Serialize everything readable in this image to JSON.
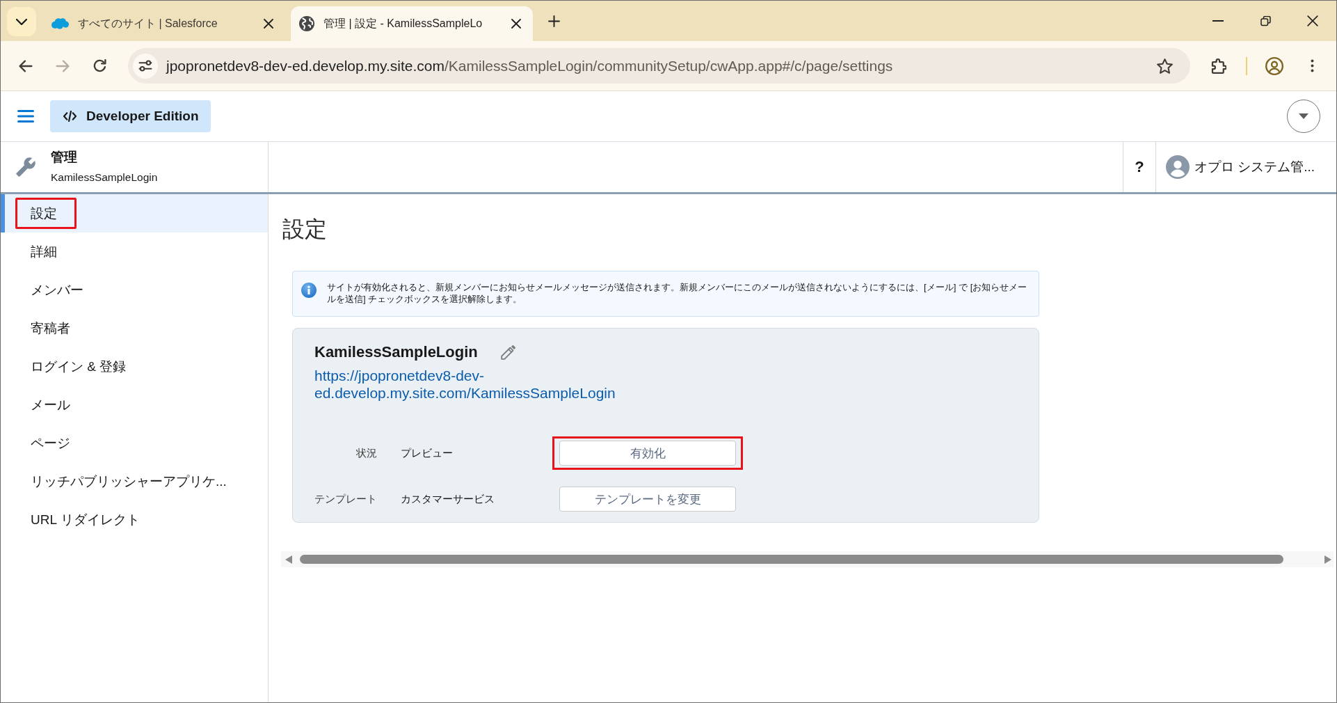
{
  "browser": {
    "tabs": [
      {
        "kind": "cloud",
        "title": "すべてのサイト | Salesforce",
        "selected": false
      },
      {
        "kind": "globe",
        "title": "管理 | 設定 - KamilessSampleLo",
        "selected": true
      }
    ],
    "navigation": [
      {
        "kind": "back",
        "disabled": false
      },
      {
        "kind": "forward",
        "disabled": true
      },
      {
        "kind": "reload",
        "disabled": false
      }
    ],
    "address": {
      "host": "jpopronetdev8-dev-ed.develop.my.site.com",
      "path": "/KamilessSampleLogin/communitySetup/cwApp.app#/c/page/settings"
    }
  },
  "app_header": {
    "edition_badge": "Developer Edition"
  },
  "admin_header": {
    "title": "管理",
    "subtitle": "KamilessSampleLogin",
    "help": "?",
    "user_name": "オプロ システム管..."
  },
  "sidebar": {
    "items": [
      {
        "label": "設定",
        "selected": true,
        "highlighted": true
      },
      {
        "label": "詳細",
        "selected": false,
        "highlighted": false
      },
      {
        "label": "メンバー",
        "selected": false,
        "highlighted": false
      },
      {
        "label": "寄稿者",
        "selected": false,
        "highlighted": false
      },
      {
        "label": "ログイン & 登録",
        "selected": false,
        "highlighted": false
      },
      {
        "label": "メール",
        "selected": false,
        "highlighted": false
      },
      {
        "label": "ページ",
        "selected": false,
        "highlighted": false
      },
      {
        "label": "リッチパブリッシャーアプリケ...",
        "selected": false,
        "highlighted": false
      },
      {
        "label": "URL リダイレクト",
        "selected": false,
        "highlighted": false
      }
    ]
  },
  "main": {
    "title": "設定",
    "notice": "サイトが有効化されると、新規メンバーにお知らせメールメッセージが送信されます。新規メンバーにこのメールが送信されないようにするには、[メール] で [お知らせメールを送信] チェックボックスを選択解除します。",
    "site_card": {
      "name": "KamilessSampleLogin",
      "url": "https://jpopronetdev8-dev-ed.develop.my.site.com/KamilessSampleLogin",
      "rows": [
        {
          "label": "状況",
          "value": "プレビュー",
          "button": {
            "label": "有効化",
            "highlighted": true
          }
        },
        {
          "label": "テンプレート",
          "value": "カスタマーサービス",
          "button": {
            "label": "テンプレートを変更",
            "highlighted": false
          }
        }
      ]
    }
  }
}
